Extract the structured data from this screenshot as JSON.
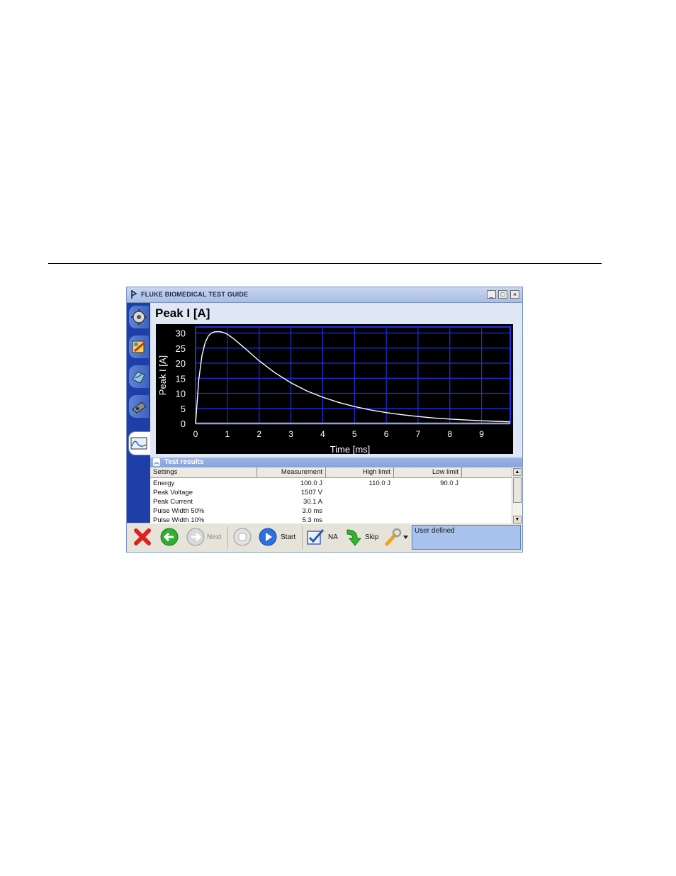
{
  "window": {
    "title": "FLUKE BIOMEDICAL TEST GUIDE",
    "minimize_glyph": "_",
    "maximize_glyph": "□",
    "close_glyph": "×"
  },
  "page": {
    "title": "Peak I [A]"
  },
  "sidebar": {
    "tabs": [
      {
        "icon": "gear-wizard-icon"
      },
      {
        "icon": "edit-form-icon"
      },
      {
        "icon": "instrument-icon"
      },
      {
        "icon": "device-icon"
      },
      {
        "icon": "waveform-icon",
        "active": true
      }
    ]
  },
  "chart_data": {
    "type": "line",
    "title": "",
    "xlabel": "Time [ms]",
    "ylabel": "Peak I [A]",
    "xlim": [
      0,
      9.9
    ],
    "ylim": [
      0,
      32
    ],
    "xticks": [
      0,
      1,
      2,
      3,
      4,
      5,
      6,
      7,
      8,
      9
    ],
    "yticks": [
      0,
      5,
      10,
      15,
      20,
      25,
      30
    ],
    "grid": true,
    "background": "#000000",
    "grid_color": "#1f2fe0",
    "line_color": "#ffffff",
    "series": [
      {
        "x": [
          0,
          0.1,
          0.2,
          0.3,
          0.4,
          0.5,
          0.6,
          0.7,
          0.8,
          0.9,
          1.0,
          1.2,
          1.4,
          1.6,
          1.8,
          2.0,
          2.5,
          3.0,
          3.5,
          4.0,
          4.5,
          5.0,
          5.5,
          6.0,
          6.5,
          7.0,
          7.5,
          8.0,
          8.5,
          9.0,
          9.5,
          9.9
        ],
        "y": [
          0,
          14.5,
          22.5,
          26.8,
          29.0,
          30.0,
          30.4,
          30.5,
          30.4,
          30.1,
          29.6,
          28.1,
          26.3,
          24.5,
          22.6,
          20.8,
          16.8,
          13.5,
          10.8,
          8.7,
          7.0,
          5.6,
          4.5,
          3.6,
          2.9,
          2.3,
          1.8,
          1.45,
          1.15,
          0.9,
          0.7,
          0.55
        ]
      }
    ]
  },
  "results": {
    "section_title": "Test results",
    "collapse_glyph": "︽",
    "columns": [
      "Settings",
      "Measurement",
      "High limit",
      "Low limit"
    ],
    "rows": [
      {
        "name": "Energy",
        "measurement": "100.0 J",
        "high": "110.0 J",
        "low": "90.0 J"
      },
      {
        "name": "Peak Voltage",
        "measurement": "1507 V",
        "high": "",
        "low": ""
      },
      {
        "name": "Peak Current",
        "measurement": "30.1 A",
        "high": "",
        "low": ""
      },
      {
        "name": "Pulse Width 50%",
        "measurement": "3.0 ms",
        "high": "",
        "low": ""
      },
      {
        "name": "Pulse Width 10%",
        "measurement": "5.3 ms",
        "high": "",
        "low": ""
      }
    ],
    "scroll_up_glyph": "▲",
    "scroll_down_glyph": "▼"
  },
  "toolbar": {
    "next_label": "Next",
    "start_label": "Start",
    "na_label": "NA",
    "skip_label": "Skip",
    "user_defined": "User defined",
    "colors": {
      "cancel": "#e02020",
      "back": "#2fae2f",
      "start": "#2e6fe0",
      "skip": "#2fb52f",
      "wrench": "#f0a020"
    }
  }
}
